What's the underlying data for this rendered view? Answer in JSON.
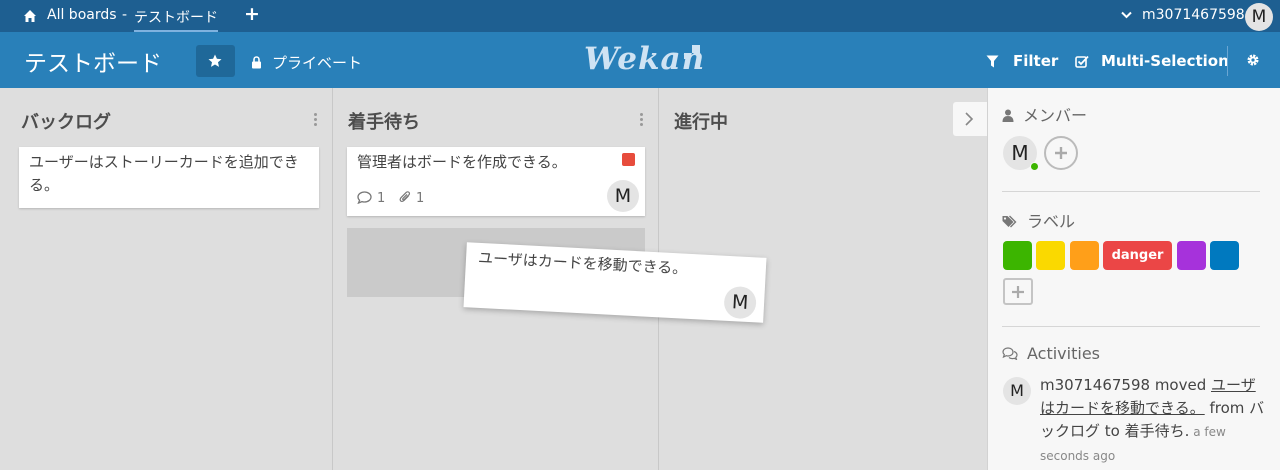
{
  "topbar": {
    "all_boards": "All boards",
    "separator": "-",
    "current_board": "テストボード",
    "add": "+",
    "username": "m3071467598",
    "avatar_initial": "M"
  },
  "header": {
    "board_title": "テストボード",
    "privacy": "プライベート",
    "logo": "Wekan",
    "filter": "Filter",
    "multi_selection": "Multi-Selection"
  },
  "lists": [
    {
      "title": "バックログ",
      "cards": [
        {
          "text": "ユーザーはストーリーカードを追加できる。"
        }
      ]
    },
    {
      "title": "着手待ち",
      "cards": [
        {
          "text": "管理者はボードを作成できる。",
          "label_color": "#e74c3c",
          "comments": "1",
          "attachments": "1",
          "member": "M"
        }
      ]
    },
    {
      "title": "進行中",
      "cards": []
    }
  ],
  "dragged_card": {
    "text": "ユーザはカードを移動できる。",
    "member": "M"
  },
  "sidebar": {
    "members_title": "メンバー",
    "member_initial": "M",
    "labels_title": "ラベル",
    "labels": [
      {
        "name": "",
        "color": "#3cb500"
      },
      {
        "name": "",
        "color": "#fad900"
      },
      {
        "name": "",
        "color": "#ff9f19"
      },
      {
        "name": "danger",
        "color": "#eb4646"
      },
      {
        "name": "",
        "color": "#a632db"
      },
      {
        "name": "",
        "color": "#0079bf"
      }
    ],
    "activities_title": "Activities",
    "activity": {
      "avatar": "M",
      "user": "m3071467598",
      "verb": " moved ",
      "card": "ユーザはカードを移動できる。",
      "from_word": " from ",
      "from_list": "バックログ",
      "to_word": " to ",
      "to_list": "着手待ち.",
      "time": " a few seconds ago"
    }
  },
  "colors": {
    "topbar": "#1e5f91",
    "header": "#2980b9",
    "board_bg": "#dedede"
  }
}
